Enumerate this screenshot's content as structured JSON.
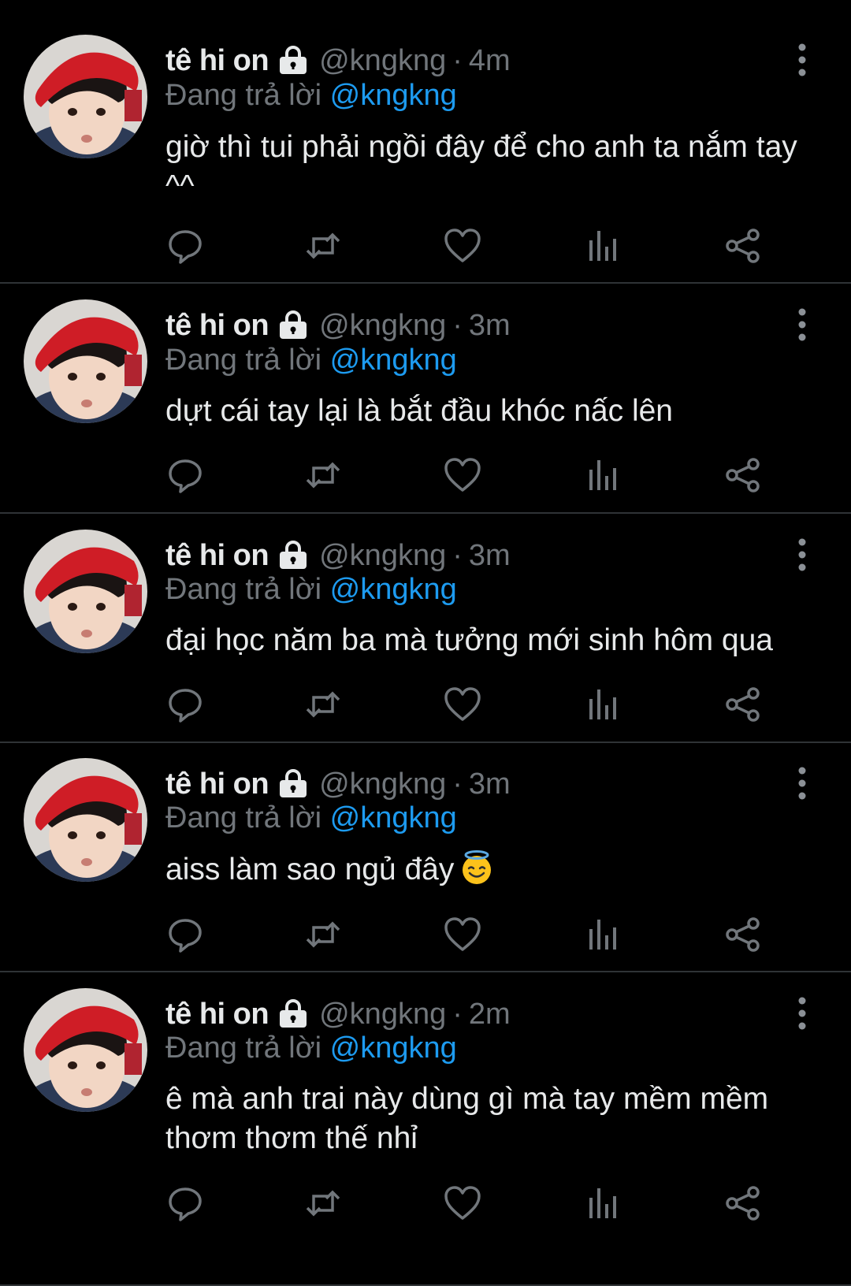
{
  "colors": {
    "background": "#000000",
    "text": "#e7e9ea",
    "muted": "#71767b",
    "mention": "#1d9bf0",
    "divider": "#2f3336"
  },
  "tweets": [
    {
      "display_name": "tê hi on",
      "handle": "@kngkng",
      "separator": "·",
      "time": "4m",
      "reply_prefix": "Đang trả lời",
      "reply_to": "@kngkng",
      "text": "giờ thì tui phải ngồi đây để cho anh ta nắm tay ^^"
    },
    {
      "display_name": "tê hi on",
      "handle": "@kngkng",
      "separator": "·",
      "time": "3m",
      "reply_prefix": "Đang trả lời",
      "reply_to": "@kngkng",
      "text": "dựt cái tay lại là bắt đầu khóc nấc lên"
    },
    {
      "display_name": "tê hi on",
      "handle": "@kngkng",
      "separator": "·",
      "time": "3m",
      "reply_prefix": "Đang trả lời",
      "reply_to": "@kngkng",
      "text": "đại học năm ba mà tưởng mới sinh hôm qua"
    },
    {
      "display_name": "tê hi on",
      "handle": "@kngkng",
      "separator": "·",
      "time": "3m",
      "reply_prefix": "Đang trả lời",
      "reply_to": "@kngkng",
      "text": "aiss làm sao ngủ đây",
      "emoji": "smiling-face-with-halo"
    },
    {
      "display_name": "tê hi on",
      "handle": "@kngkng",
      "separator": "·",
      "time": "2m",
      "reply_prefix": "Đang trả lời",
      "reply_to": "@kngkng",
      "text": "ê mà anh trai này dùng gì mà tay mềm mềm thơm thơm thế nhỉ"
    }
  ],
  "icons": {
    "verified": "lock-icon",
    "more": "more-vertical-icon",
    "actions": [
      "reply-icon",
      "retweet-icon",
      "like-icon",
      "views-icon",
      "share-icon"
    ]
  }
}
